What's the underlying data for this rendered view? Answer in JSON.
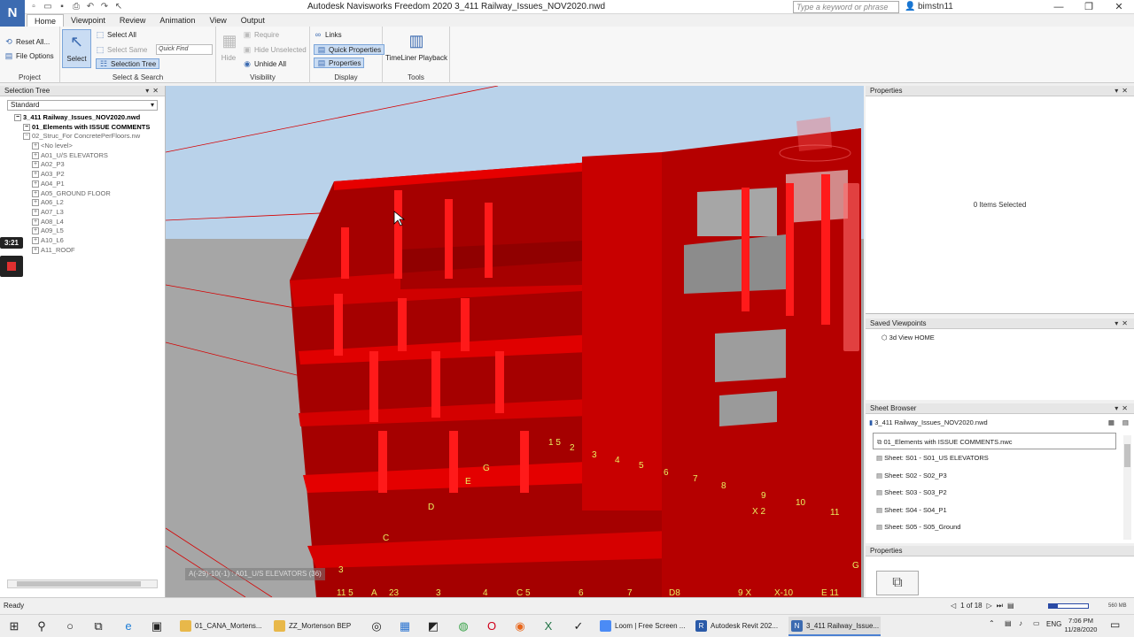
{
  "window": {
    "app_logo": "N",
    "title": "Autodesk Navisworks Freedom 2020   3_411 Railway_Issues_NOV2020.nwd",
    "search_placeholder": "Type a keyword or phrase",
    "user": "bimstn11"
  },
  "tabs": [
    "Home",
    "Viewpoint",
    "Review",
    "Animation",
    "View",
    "Output"
  ],
  "ribbon": {
    "project": {
      "label": "Project",
      "reset_all": "Reset All...",
      "file_options": "File Options"
    },
    "select_search": {
      "label": "Select & Search",
      "select": "Select",
      "select_all": "Select All",
      "select_same": "Select Same",
      "selection_tree": "Selection Tree",
      "quick_find": "Quick Find"
    },
    "visibility": {
      "label": "Visibility",
      "hide": "Hide",
      "require": "Require",
      "hide_unselected": "Hide Unselected",
      "unhide_all": "Unhide All"
    },
    "display": {
      "label": "Display",
      "links": "Links",
      "quick_properties": "Quick Properties",
      "properties": "Properties"
    },
    "tools": {
      "label": "Tools",
      "timeliner_playback": "TimeLiner Playback"
    }
  },
  "selection_tree": {
    "title": "Selection Tree",
    "mode": "Standard",
    "items": [
      {
        "label": "3_411 Railway_Issues_NOV2020.nwd",
        "level": 0,
        "style": "bold"
      },
      {
        "label": "01_Elements with ISSUE COMMENTS",
        "level": 1,
        "style": "bold"
      },
      {
        "label": "02_Struc_For ConcretePerFloors.nw",
        "level": 1,
        "style": "gray"
      },
      {
        "label": "<No level>",
        "level": 2,
        "style": "gray"
      },
      {
        "label": "A01_U/S ELEVATORS",
        "level": 2,
        "style": "gray"
      },
      {
        "label": "A02_P3",
        "level": 2,
        "style": "gray"
      },
      {
        "label": "A03_P2",
        "level": 2,
        "style": "gray"
      },
      {
        "label": "A04_P1",
        "level": 2,
        "style": "gray"
      },
      {
        "label": "A05_GROUND FLOOR",
        "level": 2,
        "style": "gray"
      },
      {
        "label": "A06_L2",
        "level": 2,
        "style": "gray"
      },
      {
        "label": "A07_L3",
        "level": 2,
        "style": "gray"
      },
      {
        "label": "A08_L4",
        "level": 2,
        "style": "gray"
      },
      {
        "label": "A09_L5",
        "level": 2,
        "style": "gray"
      },
      {
        "label": "A10_L6",
        "level": 2,
        "style": "gray"
      },
      {
        "label": "A11_ROOF",
        "level": 2,
        "style": "gray"
      }
    ]
  },
  "recorder": {
    "time": "3:21"
  },
  "viewport": {
    "hover_tooltip": "A(-29)-10(-1) : A01_U/S ELEVATORS (36)",
    "grid_labels": [
      "1 5",
      "2",
      "3",
      "4",
      "5",
      "6",
      "7",
      "8",
      "9",
      "10",
      "11",
      "G",
      "E",
      "D",
      "C",
      "X 2",
      "11 5",
      "A",
      "23",
      "3",
      "4",
      "C 5",
      "6",
      "7",
      "D8",
      "9 X",
      "X-10",
      "E 11",
      "G",
      "3"
    ]
  },
  "properties": {
    "title": "Properties",
    "status": "0 Items Selected"
  },
  "saved_viewpoints": {
    "title": "Saved Viewpoints",
    "items": [
      "3d View HOME"
    ]
  },
  "sheet_browser": {
    "title": "Sheet Browser",
    "document": "3_411 Railway_Issues_NOV2020.nwd",
    "sheets": [
      "01_Elements with ISSUE COMMENTS.nwc",
      "Sheet: S01 - S01_US ELEVATORS",
      "Sheet: S02 - S02_P3",
      "Sheet: S03 - S03_P2",
      "Sheet: S04 - S04_P1",
      "Sheet: S05 - S05_Ground"
    ]
  },
  "properties_bottom": {
    "title": "Properties"
  },
  "statusbar": {
    "status": "Ready",
    "page": "1 of 18",
    "memory": "560 MB"
  },
  "taskbar": {
    "apps": [
      {
        "label": "01_CANA_Mortens...",
        "color": "#e8b84a"
      },
      {
        "label": "ZZ_Mortenson BEP",
        "color": "#e8b84a"
      },
      {
        "label": "Loom | Free Screen ...",
        "color": "#4b8bf5"
      },
      {
        "label": "Autodesk Revit 202...",
        "color": "#2a5aa8"
      },
      {
        "label": "3_411 Railway_Issue...",
        "color": "#3c6bb1"
      }
    ],
    "language": "ENG",
    "time": "7:06 PM",
    "date": "11/28/2020"
  },
  "colors": {
    "model_red": "#d80000",
    "sky": "#b7d0e8",
    "ground": "#a8a8a8",
    "accent": "#3c6bb1"
  }
}
